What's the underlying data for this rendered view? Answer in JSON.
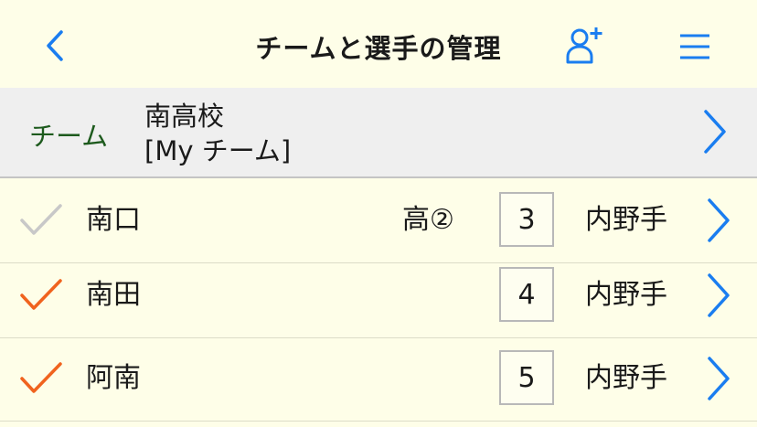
{
  "colors": {
    "accent": "#1a7df0",
    "check_on": "#f0631e",
    "check_off": "#c8c8c8",
    "team_label": "#1d5a1d",
    "background": "#fefee8",
    "team_bg": "#efefef"
  },
  "nav": {
    "title": "チームと選手の管理",
    "back_icon": "chevron-left-icon",
    "add_icon": "add-user-icon",
    "menu_icon": "hamburger-menu-icon"
  },
  "team": {
    "label": "チーム",
    "name": "南高校",
    "sub": "[My チーム]"
  },
  "players": [
    {
      "name": "南口",
      "grade": "高②",
      "number": "3",
      "position": "内野手",
      "checked": false
    },
    {
      "name": "南田",
      "grade": "",
      "number": "4",
      "position": "内野手",
      "checked": true
    },
    {
      "name": "阿南",
      "grade": "",
      "number": "5",
      "position": "内野手",
      "checked": true
    }
  ]
}
